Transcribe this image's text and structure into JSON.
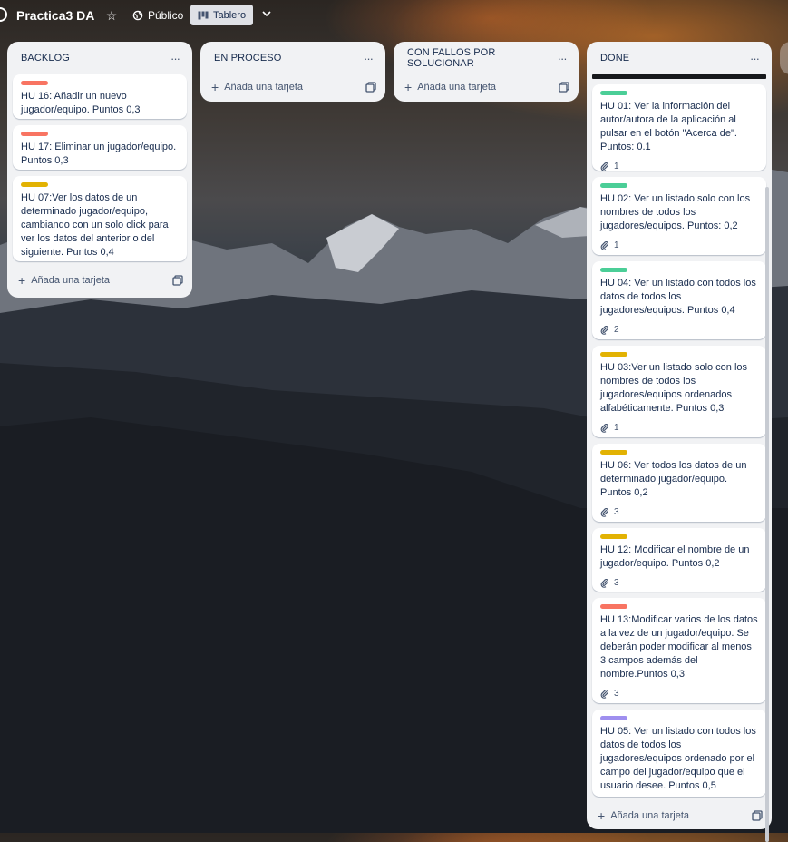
{
  "board": {
    "title": "Practica3 DA",
    "visibility": "Público",
    "view_label": "Tablero"
  },
  "colors": {
    "red": "#f87462",
    "green": "#4bce97",
    "yellow": "#e2b203",
    "purple": "#9f8fef"
  },
  "add_card_label": "Añada una tarjeta",
  "lists": [
    {
      "title": "BACKLOG",
      "cards": [
        {
          "label_color": "red",
          "text": "HU 16: Añadir un nuevo jugador/equipo. Puntos 0,3"
        },
        {
          "label_color": "red",
          "text": "HU 17: Eliminar un jugador/equipo. Puntos 0,3"
        },
        {
          "label_color": "yellow",
          "text": "HU 07:Ver los datos de un determinado jugador/equipo, cambiando con un solo click para ver los datos del anterior o del siguiente. Puntos 0,4"
        }
      ]
    },
    {
      "title": "EN PROCESO",
      "cards": []
    },
    {
      "title": "CON FALLOS POR SOLUCIONAR",
      "cards": []
    },
    {
      "title": "DONE",
      "cards": [
        {
          "label_color": "green",
          "text": "HU 01: Ver la información del autor/autora de la aplicación al pulsar en el botón \"Acerca de\". Puntos: 0.1",
          "attachments": "1"
        },
        {
          "label_color": "green",
          "text": "HU 02: Ver un listado solo con los nombres de todos los jugadores/equipos. Puntos: 0,2",
          "attachments": "1"
        },
        {
          "label_color": "green",
          "text": "HU 04: Ver un listado con todos los datos de todos los jugadores/equipos. Puntos 0,4",
          "attachments": "2"
        },
        {
          "label_color": "yellow",
          "text": "HU 03:Ver un listado solo con los nombres de todos los jugadores/equipos ordenados alfabéticamente. Puntos 0,3",
          "attachments": "1"
        },
        {
          "label_color": "yellow",
          "text": "HU 06: Ver todos los datos de un determinado jugador/equipo. Puntos 0,2",
          "attachments": "3"
        },
        {
          "label_color": "yellow",
          "text": "HU 12: Modificar el nombre de un jugador/equipo. Puntos 0,2",
          "attachments": "3"
        },
        {
          "label_color": "red",
          "text": "HU 13:Modificar varios de los datos a la vez de un jugador/equipo. Se deberán poder modificar al menos 3 campos además del nombre.Puntos 0,3",
          "attachments": "3"
        },
        {
          "label_color": "purple",
          "text": "HU 05: Ver un listado con todos los datos de todos los jugadores/equipos ordenado por el campo del jugador/equipo que el usuario desee. Puntos 0,5"
        }
      ]
    }
  ]
}
